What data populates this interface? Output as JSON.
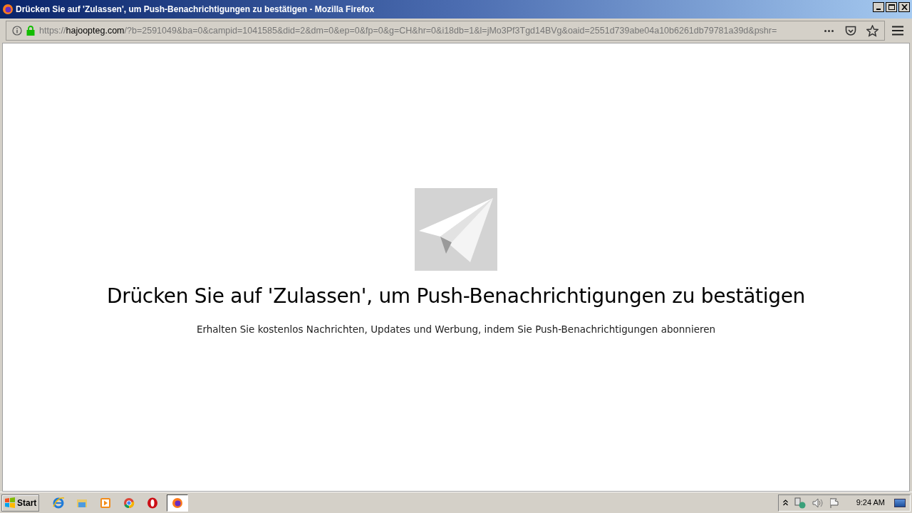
{
  "window": {
    "title": "Drücken Sie auf 'Zulassen', um Push-Benachrichtigungen zu bestätigen - Mozilla Firefox"
  },
  "address_bar": {
    "scheme": "https://",
    "host": "hajoopteg.com",
    "rest": "/?b=2591049&ba=0&campid=1041585&did=2&dm=0&ep=0&fp=0&g=CH&hr=0&i18db=1&l=jMo3Pf3Tgd14BVg&oaid=2551d739abe04a10b6261db79781a39d&pshr="
  },
  "page": {
    "heading": "Drücken Sie auf 'Zulassen', um Push-Benachrichtigungen zu bestätigen",
    "subtitle": "Erhalten Sie kostenlos Nachrichten, Updates und Werbung, indem Sie Push-Benachrichtigungen abonnieren"
  },
  "taskbar": {
    "start": "Start",
    "apps": [
      {
        "kind": "ie",
        "selected": false
      },
      {
        "kind": "folder",
        "selected": false
      },
      {
        "kind": "media",
        "selected": false
      },
      {
        "kind": "chrome",
        "selected": false
      },
      {
        "kind": "opera",
        "selected": false
      },
      {
        "kind": "firefox",
        "selected": true
      }
    ],
    "clock": "9:24 AM"
  }
}
